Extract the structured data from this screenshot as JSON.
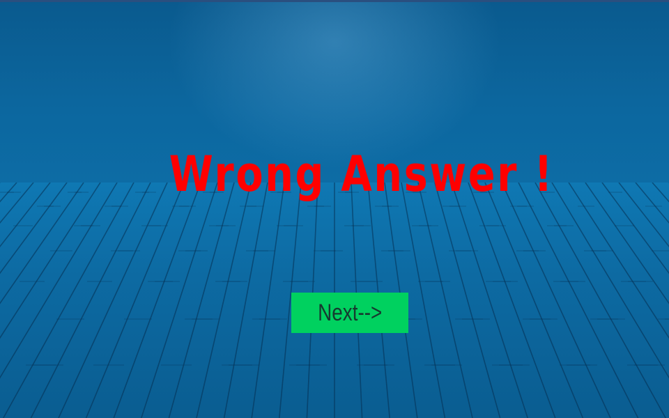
{
  "screen": {
    "message": "Wrong Answer !",
    "next_label": "Next-->"
  },
  "colors": {
    "message": "#ff0000",
    "button_bg": "#00d15f",
    "button_text": "#163a2f",
    "background": "#0b6096"
  }
}
